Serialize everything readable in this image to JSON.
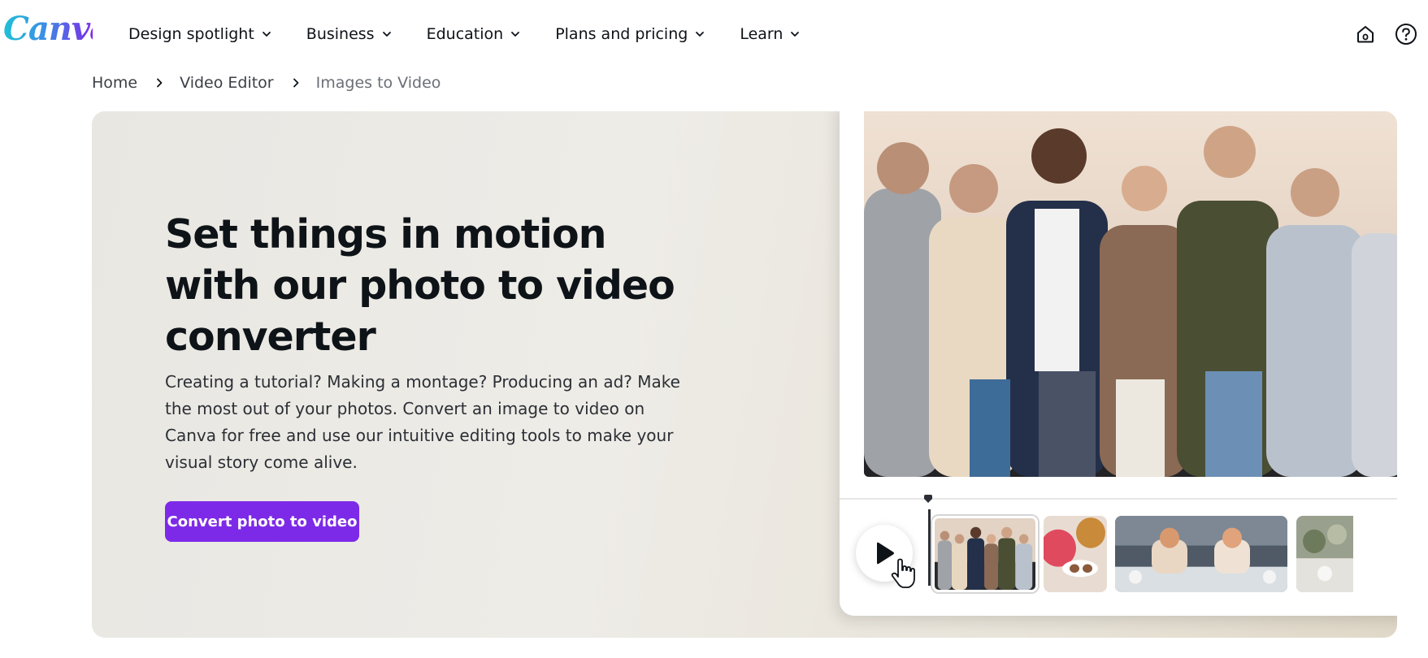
{
  "header": {
    "logo_text": "Canva",
    "nav": [
      {
        "label": "Design spotlight"
      },
      {
        "label": "Business"
      },
      {
        "label": "Education"
      },
      {
        "label": "Plans and pricing"
      },
      {
        "label": "Learn"
      }
    ],
    "icons": [
      "home-icon",
      "help-icon"
    ]
  },
  "breadcrumb": {
    "items": [
      {
        "label": "Home"
      },
      {
        "label": "Video Editor"
      },
      {
        "label": "Images to Video"
      }
    ]
  },
  "hero": {
    "title": "Set things in motion with our photo to video converter",
    "description": "Creating a tutorial? Making a montage? Producing an ad? Make the most out of your photos. Convert an image to video on Canva for free and use our intuitive editing tools to make your visual story come alive.",
    "cta_label": "Convert photo to video"
  },
  "colors": {
    "brand_purple": "#7d2ae8",
    "logo_gradient_start": "#1fc1d6",
    "logo_gradient_end": "#7d2ae8"
  },
  "editor_mock": {
    "icons": [
      "play-icon",
      "pointer-hand-icon",
      "playhead-marker-icon"
    ],
    "clips": [
      "group-photo-clip",
      "food-drinks-clip",
      "dinner-party-clip",
      "table-clip"
    ]
  }
}
